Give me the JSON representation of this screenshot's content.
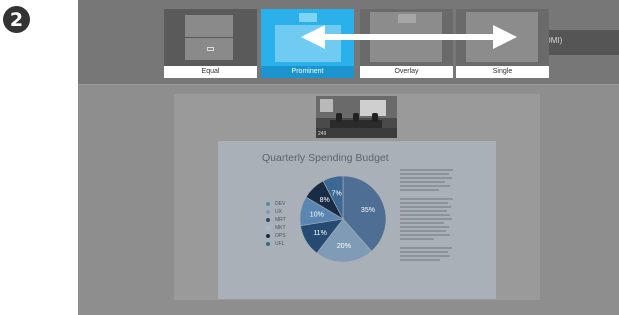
{
  "step_badge": "2",
  "header": {
    "hdmi_label": "DMI)",
    "layout_options": [
      {
        "label": "Equal",
        "selected": false
      },
      {
        "label": "Prominent",
        "selected": true
      },
      {
        "label": "Overlay",
        "selected": false
      },
      {
        "label": "Single",
        "selected": false
      }
    ],
    "drag_arrow": "double-headed-arrow-icon"
  },
  "camera_preview": {
    "tag": "249"
  },
  "presentation": {
    "title": "Quarterly Spending Budget",
    "chart_data": {
      "type": "pie",
      "title": "Quarterly Spending Budget",
      "categories": [
        "DEV",
        "UX",
        "MRT",
        "MKT",
        "OPS",
        "UFL"
      ],
      "slices": [
        {
          "label": "35%",
          "value": 35,
          "color": "#4e6f93"
        },
        {
          "label": "20%",
          "value": 20,
          "color": "#7f9bb6"
        },
        {
          "label": "11%",
          "value": 11,
          "color": "#264b73"
        },
        {
          "label": "10%",
          "value": 10,
          "color": "#5b86b1"
        },
        {
          "label": "8%",
          "value": 8,
          "color": "#1a2c45"
        },
        {
          "label": "7%",
          "value": 7,
          "color": "#3c6896"
        }
      ],
      "legend_colors": [
        "#5b86b1",
        "#7f9bb6",
        "#264b73",
        "#a4bbd1",
        "#1a2c45",
        "#3c6896"
      ]
    }
  },
  "colors": {
    "selected_accent": "#26a9e6",
    "screen_bg": "#8e8e8e"
  }
}
